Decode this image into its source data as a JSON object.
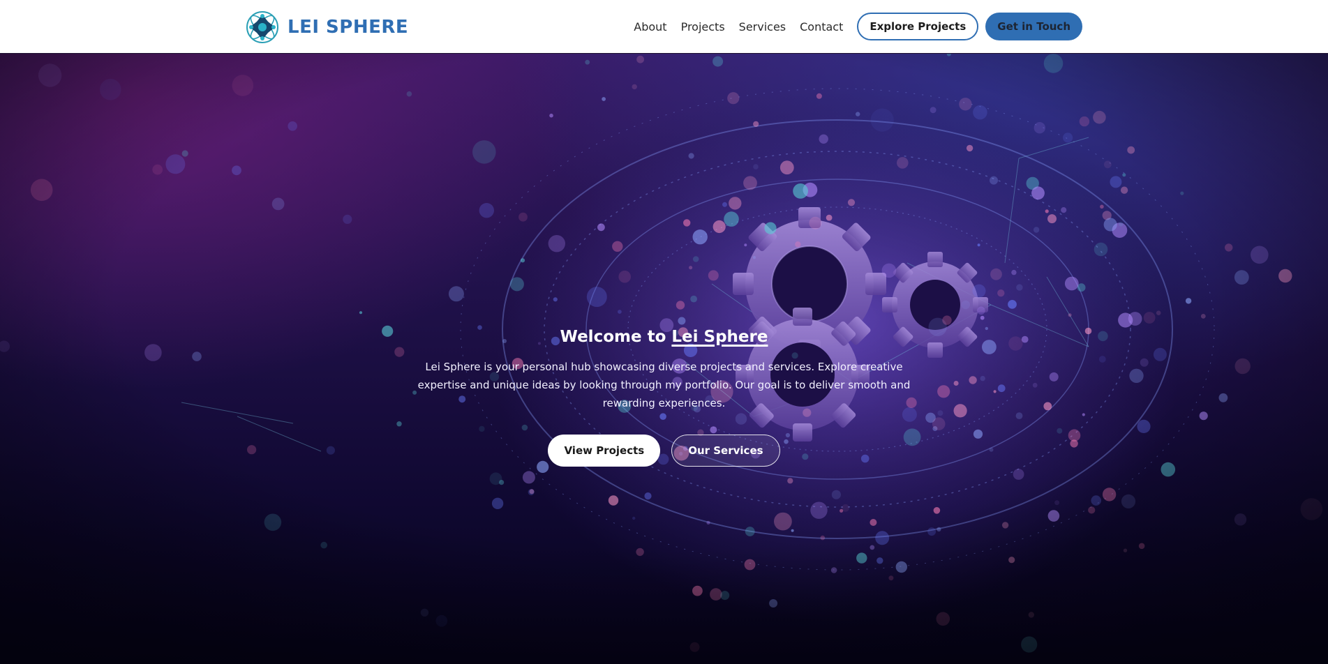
{
  "brand": {
    "name": "LEI SPHERE",
    "logo_icon": "sphere-logo-icon"
  },
  "nav": {
    "links": [
      "About",
      "Projects",
      "Services",
      "Contact"
    ],
    "explore_label": "Explore Projects",
    "contact_label": "Get in Touch"
  },
  "hero": {
    "title_prefix": "Welcome to ",
    "title_highlight": "Lei Sphere",
    "description": "Lei Sphere is your personal hub showcasing diverse projects and services. Explore creative expertise and unique ideas by looking through my portfolio. Our goal is to deliver smooth and rewarding experiences.",
    "primary_label": "View Projects",
    "secondary_label": "Our Services",
    "background_icon": "gears-network-illustration"
  },
  "colors": {
    "brand": "#2f6eb3",
    "header_bg": "#ffffff",
    "hero_dark": "#0f0830",
    "hero_purple": "#3a1a66"
  }
}
